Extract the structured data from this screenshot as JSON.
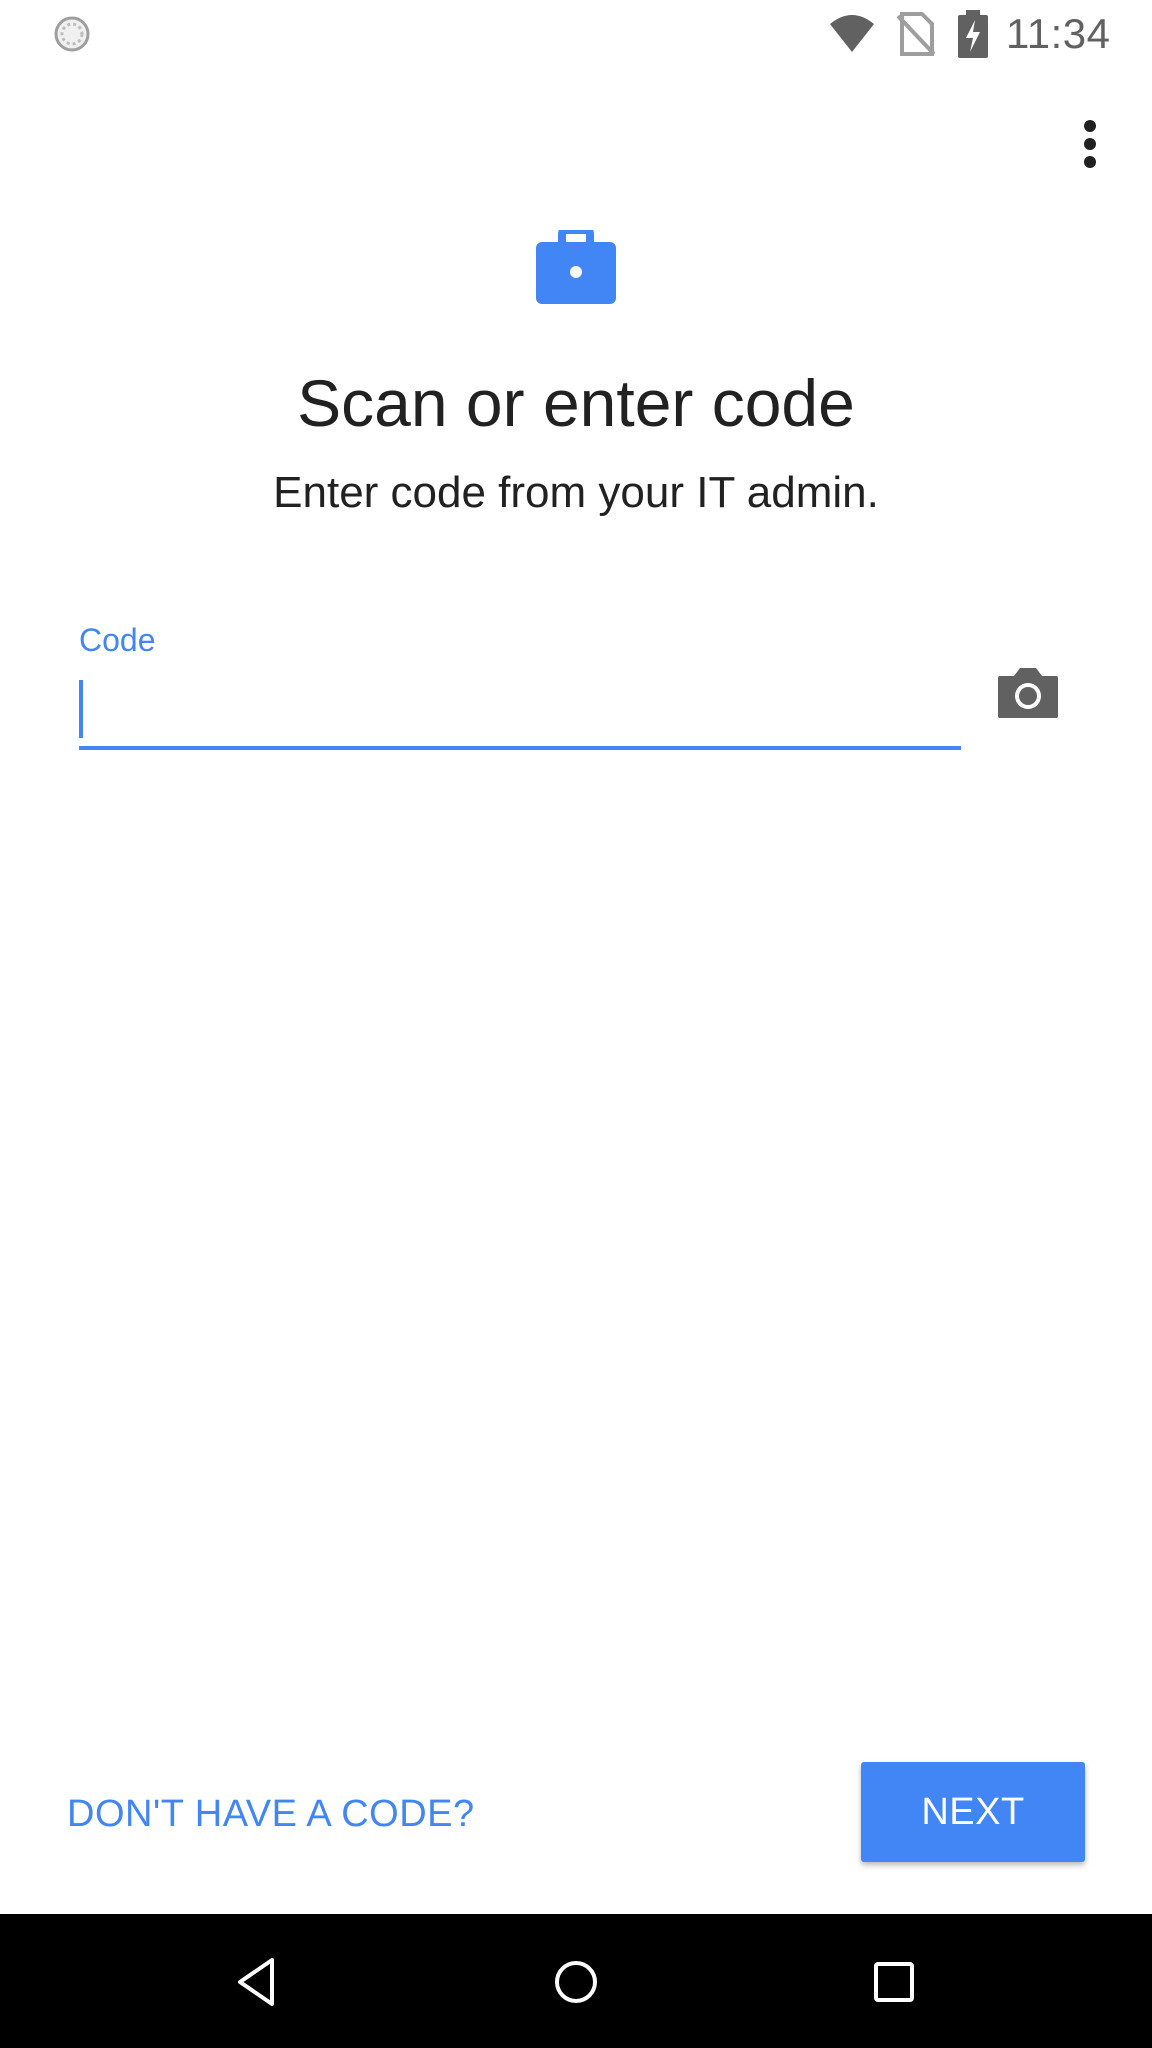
{
  "status_bar": {
    "time": "11:34",
    "icons": [
      "sync-icon",
      "wifi-icon",
      "no-sim-icon",
      "battery-charging-icon"
    ]
  },
  "header": {
    "overflow_icon": "more-vert-icon",
    "briefcase_icon": "briefcase-icon",
    "title": "Scan or enter code",
    "subtitle": "Enter code from your IT admin."
  },
  "code_field": {
    "label": "Code",
    "value": "",
    "camera_icon": "camera-icon"
  },
  "actions": {
    "no_code_label": "DON'T HAVE A CODE?",
    "next_label": "NEXT"
  },
  "nav_bar": {
    "icons": [
      "back-icon",
      "home-icon",
      "recents-icon"
    ]
  },
  "colors": {
    "accent": "#4285f4",
    "text_primary": "#212121",
    "icon_gray": "#616161",
    "nav_background": "#000000"
  }
}
